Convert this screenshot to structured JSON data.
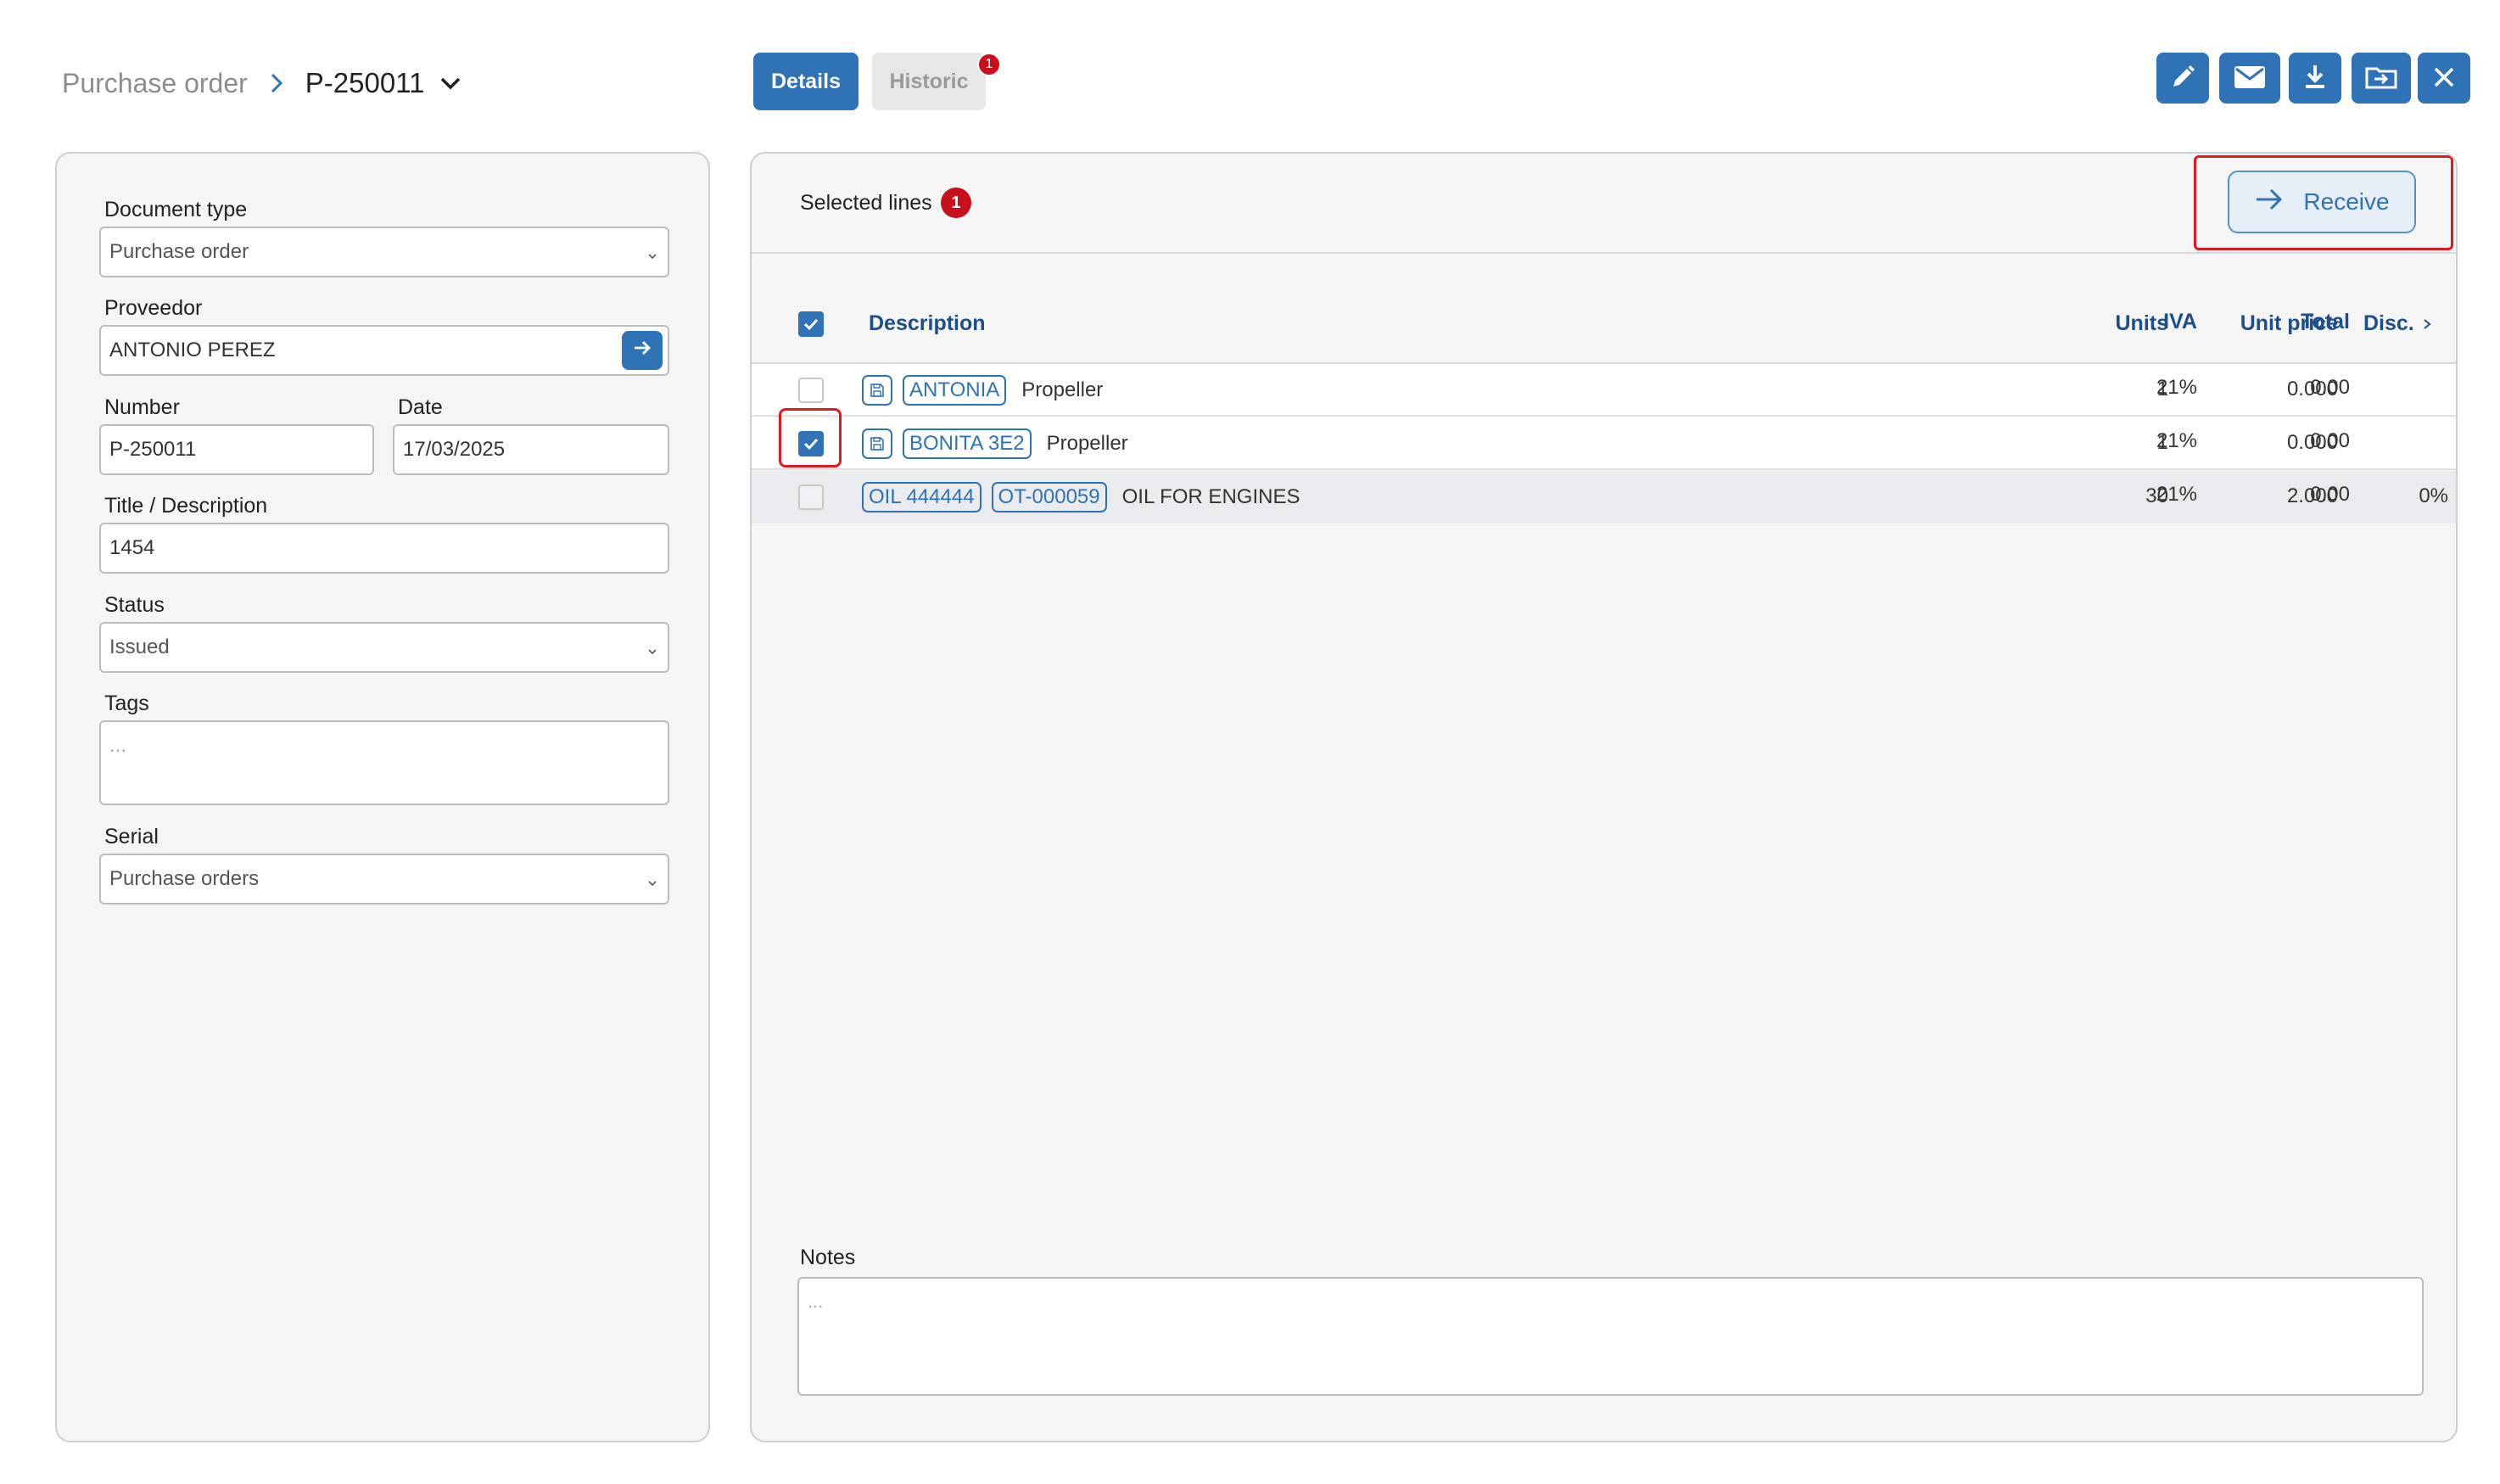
{
  "header": {
    "breadcrumb_parent": "Purchase order",
    "breadcrumb_current": "P-250011",
    "tabs": {
      "details": "Details",
      "historic": "Historic",
      "historic_badge": "1"
    },
    "toolbar_icons": [
      "edit-icon",
      "mail-icon",
      "download-icon",
      "move-to-folder-icon",
      "close-icon"
    ]
  },
  "form": {
    "document_type": {
      "label": "Document type",
      "value": "Purchase order"
    },
    "proveedor": {
      "label": "Proveedor",
      "value": "ANTONIO PEREZ"
    },
    "number": {
      "label": "Number",
      "value": "P-250011"
    },
    "date": {
      "label": "Date",
      "value": "17/03/2025"
    },
    "title": {
      "label": "Title / Description",
      "value": "1454"
    },
    "status": {
      "label": "Status",
      "value": "Issued"
    },
    "tags": {
      "label": "Tags",
      "placeholder": "..."
    },
    "serial": {
      "label": "Serial",
      "value": "Purchase orders"
    }
  },
  "lines": {
    "selected_label": "Selected lines",
    "selected_count": "1",
    "receive_label": "Receive",
    "columns": {
      "description": "Description",
      "units": "Units",
      "unit_price": "Unit price",
      "disc": "Disc.",
      "iva": "IVA",
      "total": "Total"
    },
    "header_checked": true,
    "rows": [
      {
        "checked": false,
        "save_icon": true,
        "tags": [
          "ANTONIA"
        ],
        "description": "Propeller",
        "units": "1",
        "unit_price": "0.000",
        "disc": "",
        "iva": "21%",
        "total": "0.00"
      },
      {
        "checked": true,
        "save_icon": true,
        "tags": [
          "BONITA 3E2"
        ],
        "description": "Propeller",
        "units": "1",
        "unit_price": "0.000",
        "disc": "",
        "iva": "21%",
        "total": "0.00"
      },
      {
        "checked": false,
        "save_icon": false,
        "tags": [
          "OIL 444444",
          "OT-000059"
        ],
        "description": "OIL FOR ENGINES",
        "units": "30",
        "unit_price": "2.000",
        "disc": "0%",
        "iva": "21%",
        "total": "0.00"
      }
    ]
  },
  "notes": {
    "label": "Notes",
    "placeholder": "..."
  },
  "colors": {
    "primary": "#2f72b5",
    "badge": "#c8101c",
    "highlight": "#e0191f",
    "header_text": "#1d4e89"
  }
}
